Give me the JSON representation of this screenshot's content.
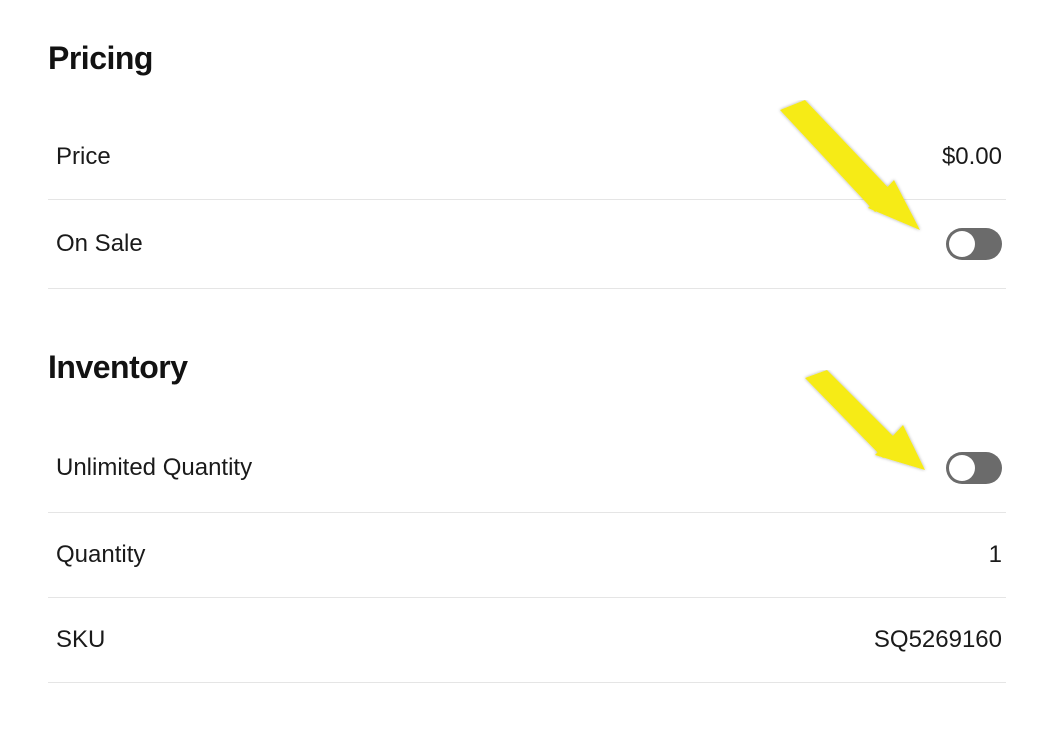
{
  "pricing": {
    "title": "Pricing",
    "rows": {
      "price": {
        "label": "Price",
        "value": "$0.00"
      },
      "on_sale": {
        "label": "On Sale"
      }
    }
  },
  "inventory": {
    "title": "Inventory",
    "rows": {
      "unlimited": {
        "label": "Unlimited Quantity"
      },
      "quantity": {
        "label": "Quantity",
        "value": "1"
      },
      "sku": {
        "label": "SKU",
        "value": "SQ5269160"
      }
    }
  }
}
